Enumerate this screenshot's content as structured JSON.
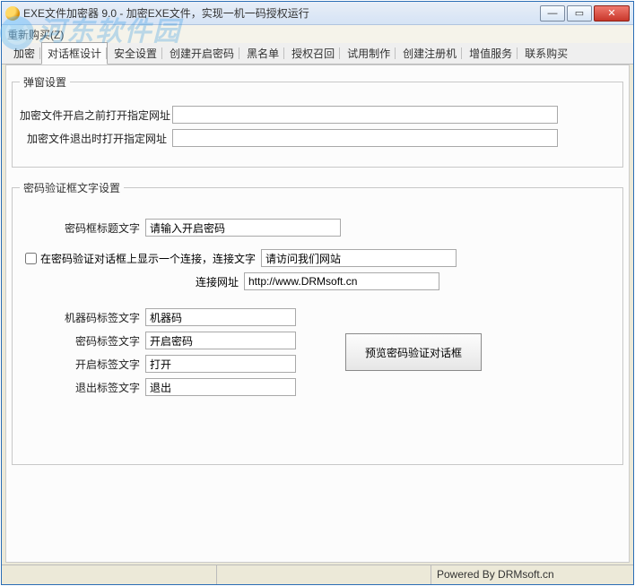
{
  "window": {
    "title": "EXE文件加密器 9.0 - 加密EXE文件，实现一机一码授权运行"
  },
  "menu": {
    "item0": "重新购买(Z)"
  },
  "tabs": {
    "t0": "加密",
    "t1": "对话框设计",
    "t2": "安全设置",
    "t3": "创建开启密码",
    "t4": "黑名单",
    "t5": "授权召回",
    "t6": "试用制作",
    "t7": "创建注册机",
    "t8": "增值服务",
    "t9": "联系购买"
  },
  "popup": {
    "legend": "弹窗设置",
    "before_label": "加密文件开启之前打开指定网址",
    "before_val": "",
    "exit_label": "加密文件退出时打开指定网址",
    "exit_val": ""
  },
  "pwbox": {
    "legend": "密码验证框文字设置",
    "title_label": "密码框标题文字",
    "title_val": "请输入开启密码",
    "chk_label": "在密码验证对话框上显示一个连接，连接文字",
    "link_text_val": "请访问我们网站",
    "link_url_label": "连接网址",
    "link_url_val": "http://www.DRMsoft.cn",
    "machine_label": "机器码标签文字",
    "machine_val": "机器码",
    "pw_label": "密码标签文字",
    "pw_val": "开启密码",
    "open_label": "开启标签文字",
    "open_val": "打开",
    "exit_label": "退出标签文字",
    "exit_val": "退出",
    "preview_btn": "预览密码验证对话框"
  },
  "status": {
    "text": "Powered By DRMsoft.cn"
  },
  "watermark": {
    "text": "河东软件园"
  }
}
